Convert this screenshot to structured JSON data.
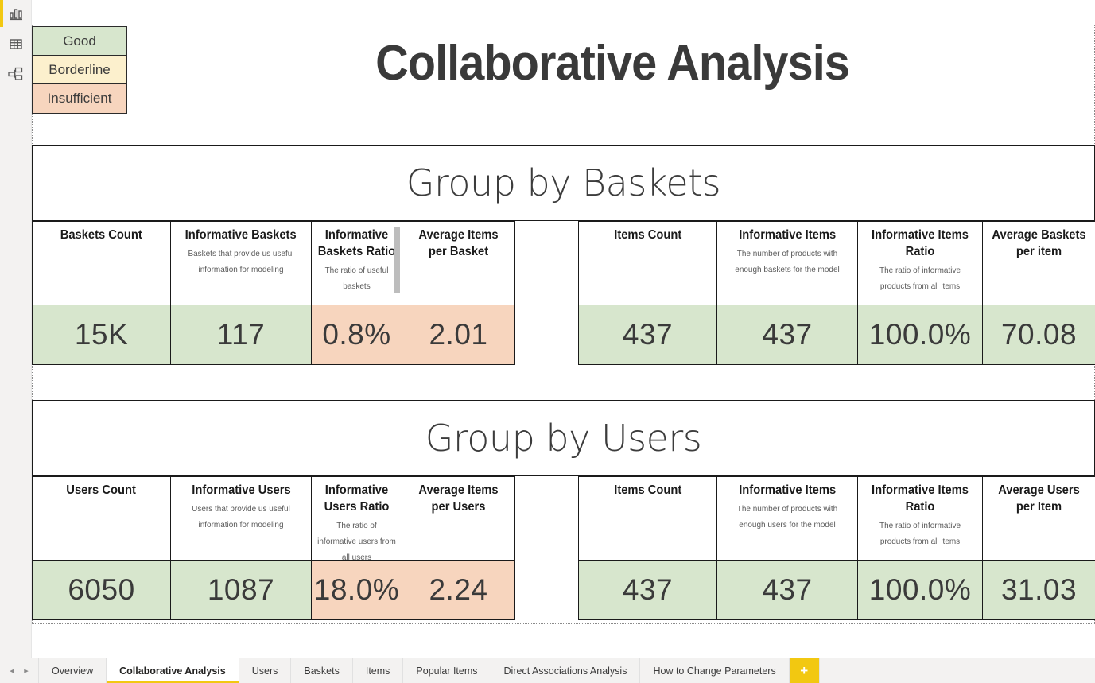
{
  "window": {
    "title": "Collaborative Analysis"
  },
  "rail": {
    "items": [
      {
        "name": "report-view-icon",
        "label": "Report"
      },
      {
        "name": "data-view-icon",
        "label": "Data"
      },
      {
        "name": "model-view-icon",
        "label": "Model"
      }
    ],
    "active_index": 0,
    "accent_color": "#f2c811"
  },
  "legend": {
    "rows": [
      {
        "label": "Good",
        "color": "#d7e6cd"
      },
      {
        "label": "Borderline",
        "color": "#fcf0cd"
      },
      {
        "label": "Insufficient",
        "color": "#f7d5be"
      }
    ]
  },
  "colors": {
    "good": "#d7e6cd",
    "borderline": "#fcf0cd",
    "insufficient": "#f7d5be",
    "accent": "#f2c811",
    "border": "#1a1a1a"
  },
  "panels": [
    {
      "id": "group-by-baskets",
      "title": "Group by Baskets",
      "left_matrix": {
        "columns": [
          {
            "title": "Baskets Count",
            "subtitle": "",
            "value": "15K",
            "status": "good"
          },
          {
            "title": "Informative Baskets",
            "subtitle": "Baskets that provide us useful information for modeling",
            "value": "117",
            "status": "good"
          },
          {
            "title": "Informative Baskets Ratio",
            "subtitle": "The ratio of useful baskets",
            "value": "0.8%",
            "status": "insufficient",
            "scrollbar": true
          },
          {
            "title": "Average Items per Basket",
            "subtitle": "",
            "value": "2.01",
            "status": "insufficient"
          }
        ]
      },
      "right_matrix": {
        "columns": [
          {
            "title": "Items Count",
            "subtitle": "",
            "value": "437",
            "status": "good"
          },
          {
            "title": "Informative Items",
            "subtitle": "The number of products with enough baskets for the model",
            "value": "437",
            "status": "good"
          },
          {
            "title": "Informative Items Ratio",
            "subtitle": "The ratio of informative products from all items",
            "value": "100.0%",
            "status": "good"
          },
          {
            "title": "Average Baskets per item",
            "subtitle": "",
            "value": "70.08",
            "status": "good"
          }
        ]
      }
    },
    {
      "id": "group-by-users",
      "title": "Group by Users",
      "left_matrix": {
        "columns": [
          {
            "title": "Users Count",
            "subtitle": "",
            "value": "6050",
            "status": "good"
          },
          {
            "title": "Informative Users",
            "subtitle": "Users that provide us useful information for modeling",
            "value": "1087",
            "status": "good"
          },
          {
            "title": "Informative Users Ratio",
            "subtitle": "The ratio of informative users from all users",
            "value": "18.0%",
            "status": "insufficient"
          },
          {
            "title": "Average Items per Users",
            "subtitle": "",
            "value": "2.24",
            "status": "insufficient"
          }
        ]
      },
      "right_matrix": {
        "columns": [
          {
            "title": "Items Count",
            "subtitle": "",
            "value": "437",
            "status": "good"
          },
          {
            "title": "Informative Items",
            "subtitle": "The number of products with enough users for the model",
            "value": "437",
            "status": "good"
          },
          {
            "title": "Informative Items Ratio",
            "subtitle": "The ratio of informative products from all items",
            "value": "100.0%",
            "status": "good"
          },
          {
            "title": "Average Users per Item",
            "subtitle": "",
            "value": "31.03",
            "status": "good"
          }
        ]
      }
    }
  ],
  "tabbar": {
    "prev_label": "◂",
    "next_label": "▸",
    "add_label": "+",
    "active_tab": "Collaborative Analysis",
    "tabs": [
      "Overview",
      "Collaborative Analysis",
      "Users",
      "Baskets",
      "Items",
      "Popular Items",
      "Direct Associations Analysis",
      "How to Change Parameters"
    ]
  }
}
